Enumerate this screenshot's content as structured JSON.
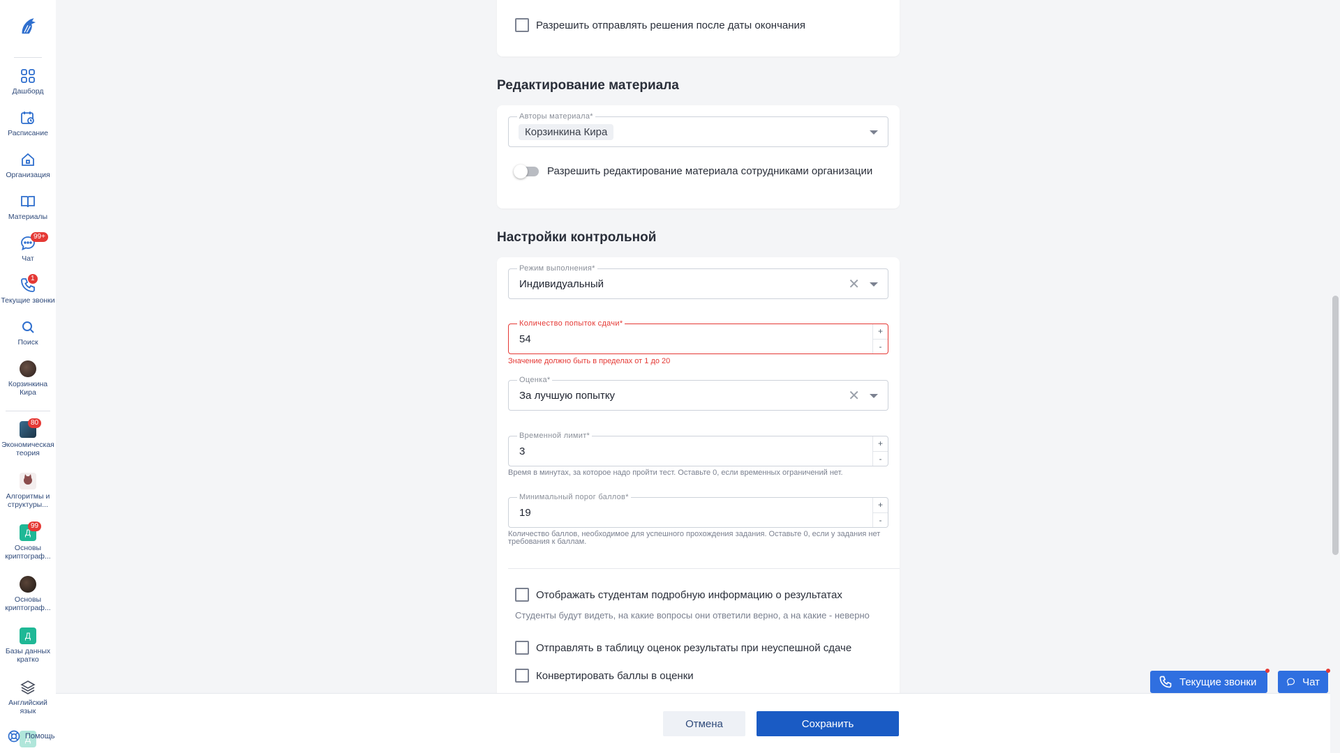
{
  "sidebar": {
    "items": [
      {
        "label": "Дашборд"
      },
      {
        "label": "Расписание"
      },
      {
        "label": "Организация"
      },
      {
        "label": "Материалы"
      },
      {
        "label": "Чат",
        "badge": "99+"
      },
      {
        "label": "Текущие звонки",
        "badge": "1"
      },
      {
        "label": "Поиск"
      },
      {
        "label": "Корзинкина Кира"
      }
    ],
    "courses": [
      {
        "label": "Экономическая теория",
        "badge": "80",
        "thumb": ""
      },
      {
        "label": "Алгоритмы и структуры...",
        "thumb": ""
      },
      {
        "label": "Основы криптограф...",
        "badge": "99",
        "thumb": "Д"
      },
      {
        "label": "Основы криптограф...",
        "thumb": ""
      },
      {
        "label": "Базы данных кратко",
        "thumb": "Д"
      },
      {
        "label": "Английский язык",
        "thumb": ""
      },
      {
        "label": "",
        "thumb": "Д"
      }
    ],
    "help_label": "Помощь"
  },
  "top_card": {
    "checkbox_label": "Разрешить отправлять решения после даты окончания"
  },
  "edit_section": {
    "title": "Редактирование материала",
    "authors_label": "Авторы материала*",
    "author_chip": "Корзинкина Кира",
    "toggle_label": "Разрешить редактирование материала сотрудниками организации"
  },
  "test_section": {
    "title": "Настройки контрольной",
    "mode": {
      "label": "Режим выполнения*",
      "value": "Индивидуальный"
    },
    "attempts": {
      "label": "Количество попыток сдачи*",
      "value": "54",
      "error": "Значение должно быть в пределах от 1 до 20"
    },
    "grade": {
      "label": "Оценка*",
      "value": "За лучшую попытку"
    },
    "time_limit": {
      "label": "Временной лимит*",
      "value": "3",
      "helper": "Время в минутах, за которое надо пройти тест. Оставьте 0, если временных ограничений нет."
    },
    "min_score": {
      "label": "Минимальный порог баллов*",
      "value": "19",
      "helper": "Количество баллов, необходимое для успешного прохождения задания. Оставьте 0, если у задания нет требования к баллам."
    },
    "stepper_plus": "+",
    "stepper_minus": "-",
    "show_results": {
      "label": "Отображать студентам подробную информацию о результатах",
      "hint": "Студенты будут видеть, на какие вопросы они ответили верно, а на какие - неверно"
    },
    "send_failed": {
      "label": "Отправлять в таблицу оценок результаты при неуспешной сдаче"
    },
    "convert_points": {
      "label": "Конвертировать баллы в оценки"
    }
  },
  "actions": {
    "cancel": "Отмена",
    "save": "Сохранить"
  },
  "floating": {
    "calls": "Текущие звонки",
    "chat": "Чат"
  },
  "colors": {
    "accent": "#1a5bc4",
    "error": "#e53935",
    "badge": "#e53935"
  }
}
